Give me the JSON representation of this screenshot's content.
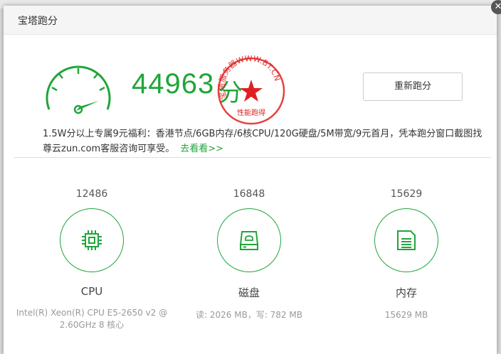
{
  "dialog": {
    "title": "宝塔跑分",
    "close_icon": "close-icon"
  },
  "summary": {
    "total_score": "44963",
    "score_unit": "分",
    "rerun_label": "重新跑分",
    "gauge_icon": "speedometer-icon",
    "seal_icon": "watermark-seal-icon",
    "seal_text": "宝塔服务器WWW.BT.CN 性能跑得"
  },
  "promo": {
    "text": "1.5W分以上专属9元福利：香港节点/6GB内存/6核CPU/120G硬盘/5M带宽/9元首月，凭本跑分窗口截图找尊云zun.com客服咨询可享受。",
    "link_label": "去看看>>"
  },
  "metrics": [
    {
      "score": "12486",
      "name": "CPU",
      "icon": "cpu-chip-icon",
      "description": "Intel(R) Xeon(R) CPU E5-2650 v2 @ 2.60GHz 8 核心"
    },
    {
      "score": "16848",
      "name": "磁盘",
      "icon": "disk-drive-icon",
      "description": "读: 2026 MB，写: 782 MB"
    },
    {
      "score": "15629",
      "name": "内存",
      "icon": "memory-card-icon",
      "description": "15629 MB"
    }
  ],
  "colors": {
    "accent": "#20a53a",
    "seal_red": "#e02020"
  }
}
